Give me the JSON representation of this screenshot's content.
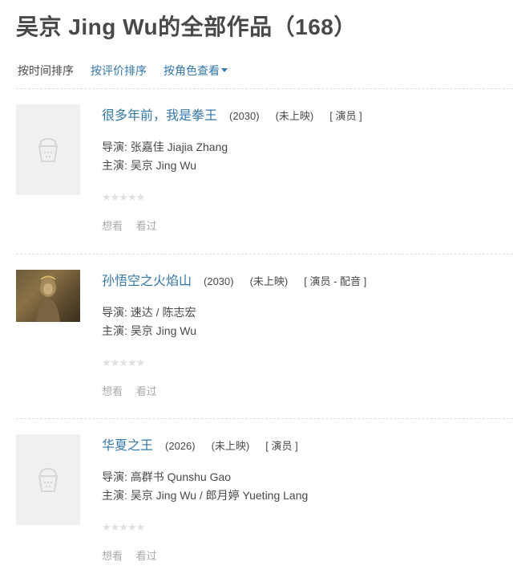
{
  "page": {
    "title": "吴京 Jing Wu的全部作品（168）"
  },
  "sort": {
    "by_time": "按时间排序",
    "by_rating": "按评价排序",
    "by_role": "按角色查看"
  },
  "works": [
    {
      "title": "很多年前，我是拳王",
      "year": "(2030)",
      "status": "(未上映)",
      "role": "[ 演员 ]",
      "director": "导演: 张嘉佳 Jiajia Zhang",
      "cast": "主演: 吴京 Jing Wu",
      "stars": "★★★★★",
      "want": "想看",
      "seen": "看过",
      "poster": "placeholder-icon"
    },
    {
      "title": "孙悟空之火焰山",
      "year": "(2030)",
      "status": "(未上映)",
      "role": "[ 演员 - 配音 ]",
      "director": "导演: 速达 / 陈志宏",
      "cast": "主演: 吴京 Jing Wu",
      "stars": "★★★★★",
      "want": "想看",
      "seen": "看过",
      "poster": "monkey-king-photo"
    },
    {
      "title": "华夏之王",
      "year": "(2026)",
      "status": "(未上映)",
      "role": "[ 演员 ]",
      "director": "导演: 高群书 Qunshu Gao",
      "cast": "主演: 吴京 Jing Wu / 郎月婷 Yueting Lang",
      "stars": "★★★★★",
      "want": "想看",
      "seen": "看过",
      "poster": "placeholder-icon"
    }
  ],
  "colors": {
    "link": "#3377aa",
    "text": "#494949",
    "muted": "#aaaaaa",
    "placeholder_bg": "#f0f0f0"
  }
}
